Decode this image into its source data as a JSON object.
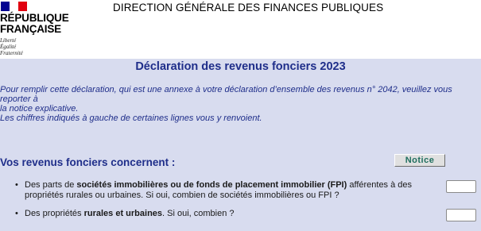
{
  "brand": {
    "marianne_lines": [
      "RÉPUBLIQUE",
      "FRANÇAISE"
    ],
    "motto_lines": [
      "Liberté",
      "Égalité",
      "Fraternité"
    ],
    "flag_colors": [
      "#000091",
      "#ffffff",
      "#e1000f"
    ]
  },
  "header": {
    "agency": "DIRECTION GÉNÉRALE DES FINANCES PUBLIQUES"
  },
  "form": {
    "title": "Déclaration des revenus fonciers 2023",
    "intro_lines": [
      "Pour remplir cette déclaration, qui est une annexe à votre déclaration d’ensemble des revenus n° 2042, veuillez vous reporter à",
      "la notice explicative.",
      "Les chiffres indiqués à gauche de certaines lignes vous y renvoient."
    ],
    "section_title": "Vos revenus fonciers concernent :",
    "notice_label": "Notice",
    "items": [
      {
        "pre": "Des parts de ",
        "bold": "sociétés immobilières ou de fonds de placement immobilier (FPI)",
        "post": " afférentes à des propriétés rurales ou urbaines. Si oui, combien de sociétés immobilières ou FPI ?",
        "value": ""
      },
      {
        "pre": "Des propriétés ",
        "bold": "rurales et urbaines",
        "post": ". Si oui, combien ?",
        "value": ""
      }
    ]
  },
  "colors": {
    "panel_bg": "#d8dcef",
    "accent_blue": "#1f2e8a",
    "notice_text": "#1f6e5e"
  }
}
